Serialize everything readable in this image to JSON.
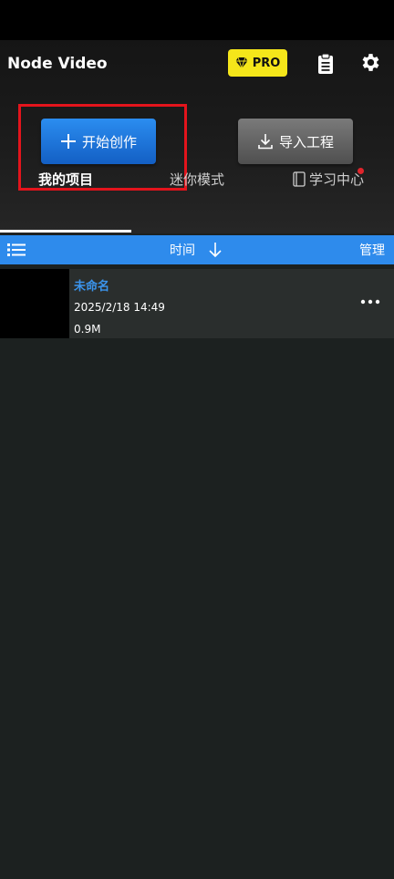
{
  "app": {
    "title": "Node Video",
    "pro_label": "PRO",
    "accent": "#2e8bec",
    "pro_color": "#f5e61a"
  },
  "actions": {
    "create_label": "开始创作",
    "import_label": "导入工程"
  },
  "tabs": [
    {
      "label": "我的项目",
      "active": true
    },
    {
      "label": "迷你模式",
      "active": false
    },
    {
      "label": "学习中心",
      "active": false,
      "badge_dot": true
    }
  ],
  "sortbar": {
    "sort_label": "时间",
    "manage_label": "管理"
  },
  "projects": [
    {
      "name": "未命名",
      "date": "2025/2/18 14:49",
      "size": "0.9M"
    }
  ],
  "icons": {
    "pro": "diamond-icon",
    "clipboard": "clipboard-icon",
    "settings": "gear-icon",
    "create": "plus-icon",
    "import": "download-icon",
    "learn": "book-icon",
    "list": "list-icon",
    "sort": "arrow-down-icon",
    "more": "more-icon"
  }
}
